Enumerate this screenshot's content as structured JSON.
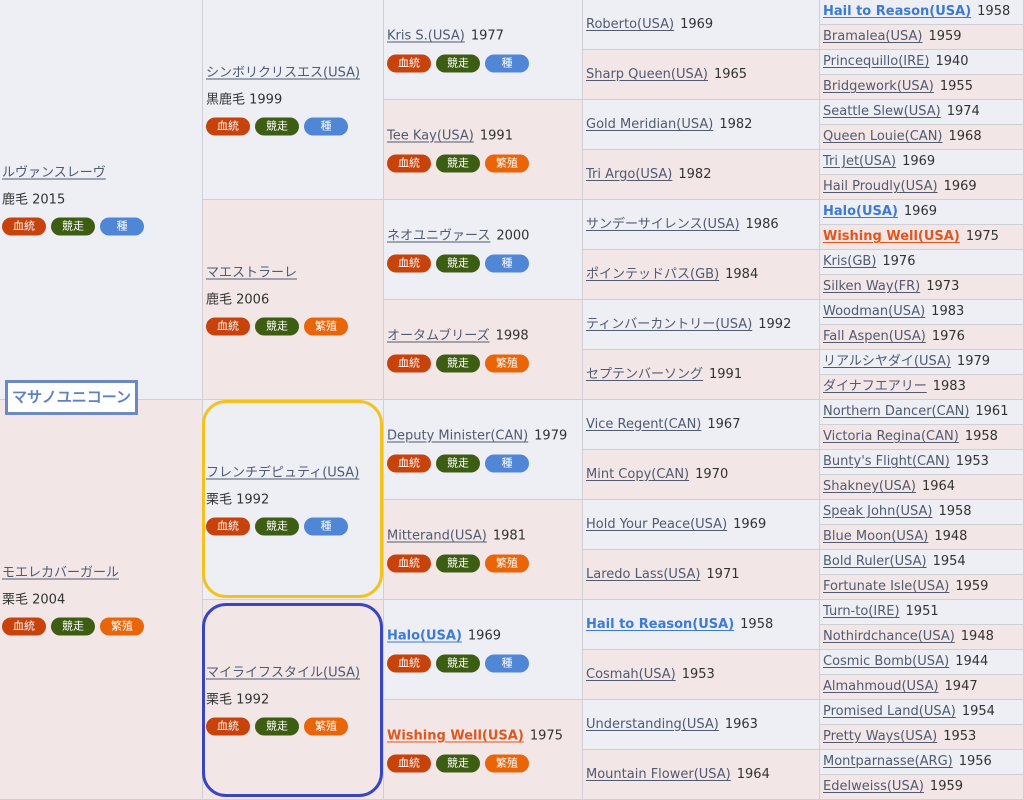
{
  "subject": "マサノユニコーン",
  "badge_labels": {
    "blood": "血統",
    "race": "競走",
    "sire": "種",
    "dam": "繁殖"
  },
  "gen1": [
    {
      "name": "ルヴァンスレーヴ",
      "coat": "鹿毛 2015"
    },
    {
      "name": "モエレカバーガール",
      "coat": "栗毛 2004"
    }
  ],
  "gen2": [
    {
      "name": "シンボリクリスエス(USA)",
      "coat": "黒鹿毛 1999"
    },
    {
      "name": "マエストラーレ",
      "coat": "鹿毛 2006"
    },
    {
      "name": "フレンチデピュティ(USA)",
      "coat": "栗毛 1992"
    },
    {
      "name": "マイライフスタイル(USA)",
      "coat": "栗毛 1992"
    }
  ],
  "gen3": [
    {
      "name": "Kris S.(USA)",
      "year": "1977"
    },
    {
      "name": "Tee Kay(USA)",
      "year": "1991"
    },
    {
      "name": "ネオユニヴァース",
      "year": "2000"
    },
    {
      "name": "オータムブリーズ",
      "year": "1998"
    },
    {
      "name": "Deputy Minister(CAN)",
      "year": "1979"
    },
    {
      "name": "Mitterand(USA)",
      "year": "1981"
    },
    {
      "name": "Halo(USA)",
      "year": "1969"
    },
    {
      "name": "Wishing Well(USA)",
      "year": "1975"
    }
  ],
  "gen4": [
    {
      "name": "Roberto(USA)",
      "year": "1969"
    },
    {
      "name": "Sharp Queen(USA)",
      "year": "1965"
    },
    {
      "name": "Gold Meridian(USA)",
      "year": "1982"
    },
    {
      "name": "Tri Argo(USA)",
      "year": "1982"
    },
    {
      "name": "サンデーサイレンス(USA)",
      "year": "1986"
    },
    {
      "name": "ポインテッドパス(GB)",
      "year": "1984"
    },
    {
      "name": "ティンバーカントリー(USA)",
      "year": "1992"
    },
    {
      "name": "セプテンバーソング",
      "year": "1991"
    },
    {
      "name": "Vice Regent(CAN)",
      "year": "1967"
    },
    {
      "name": "Mint Copy(CAN)",
      "year": "1970"
    },
    {
      "name": "Hold Your Peace(USA)",
      "year": "1969"
    },
    {
      "name": "Laredo Lass(USA)",
      "year": "1971"
    },
    {
      "name": "Hail to Reason(USA)",
      "year": "1958"
    },
    {
      "name": "Cosmah(USA)",
      "year": "1953"
    },
    {
      "name": "Understanding(USA)",
      "year": "1963"
    },
    {
      "name": "Mountain Flower(USA)",
      "year": "1964"
    }
  ],
  "gen5": [
    {
      "name": "Hail to Reason(USA)",
      "year": "1958"
    },
    {
      "name": "Bramalea(USA)",
      "year": "1959"
    },
    {
      "name": "Princequillo(IRE)",
      "year": "1940"
    },
    {
      "name": "Bridgework(USA)",
      "year": "1955"
    },
    {
      "name": "Seattle Slew(USA)",
      "year": "1974"
    },
    {
      "name": "Queen Louie(CAN)",
      "year": "1968"
    },
    {
      "name": "Tri Jet(USA)",
      "year": "1969"
    },
    {
      "name": "Hail Proudly(USA)",
      "year": "1969"
    },
    {
      "name": "Halo(USA)",
      "year": "1969"
    },
    {
      "name": "Wishing Well(USA)",
      "year": "1975"
    },
    {
      "name": "Kris(GB)",
      "year": "1976"
    },
    {
      "name": "Silken Way(FR)",
      "year": "1973"
    },
    {
      "name": "Woodman(USA)",
      "year": "1983"
    },
    {
      "name": "Fall Aspen(USA)",
      "year": "1976"
    },
    {
      "name": "リアルシヤダイ(USA)",
      "year": "1979"
    },
    {
      "name": "ダイナフエアリー",
      "year": "1983"
    },
    {
      "name": "Northern Dancer(CAN)",
      "year": "1961"
    },
    {
      "name": "Victoria Regina(CAN)",
      "year": "1958"
    },
    {
      "name": "Bunty's Flight(CAN)",
      "year": "1953"
    },
    {
      "name": "Shakney(USA)",
      "year": "1964"
    },
    {
      "name": "Speak John(USA)",
      "year": "1958"
    },
    {
      "name": "Blue Moon(USA)",
      "year": "1948"
    },
    {
      "name": "Bold Ruler(USA)",
      "year": "1954"
    },
    {
      "name": "Fortunate Isle(USA)",
      "year": "1959"
    },
    {
      "name": "Turn-to(IRE)",
      "year": "1951"
    },
    {
      "name": "Nothirdchance(USA)",
      "year": "1948"
    },
    {
      "name": "Cosmic Bomb(USA)",
      "year": "1944"
    },
    {
      "name": "Almahmoud(USA)",
      "year": "1947"
    },
    {
      "name": "Promised Land(USA)",
      "year": "1954"
    },
    {
      "name": "Pretty Ways(USA)",
      "year": "1953"
    },
    {
      "name": "Montparnasse(ARG)",
      "year": "1956"
    },
    {
      "name": "Edelweiss(USA)",
      "year": "1959"
    }
  ]
}
